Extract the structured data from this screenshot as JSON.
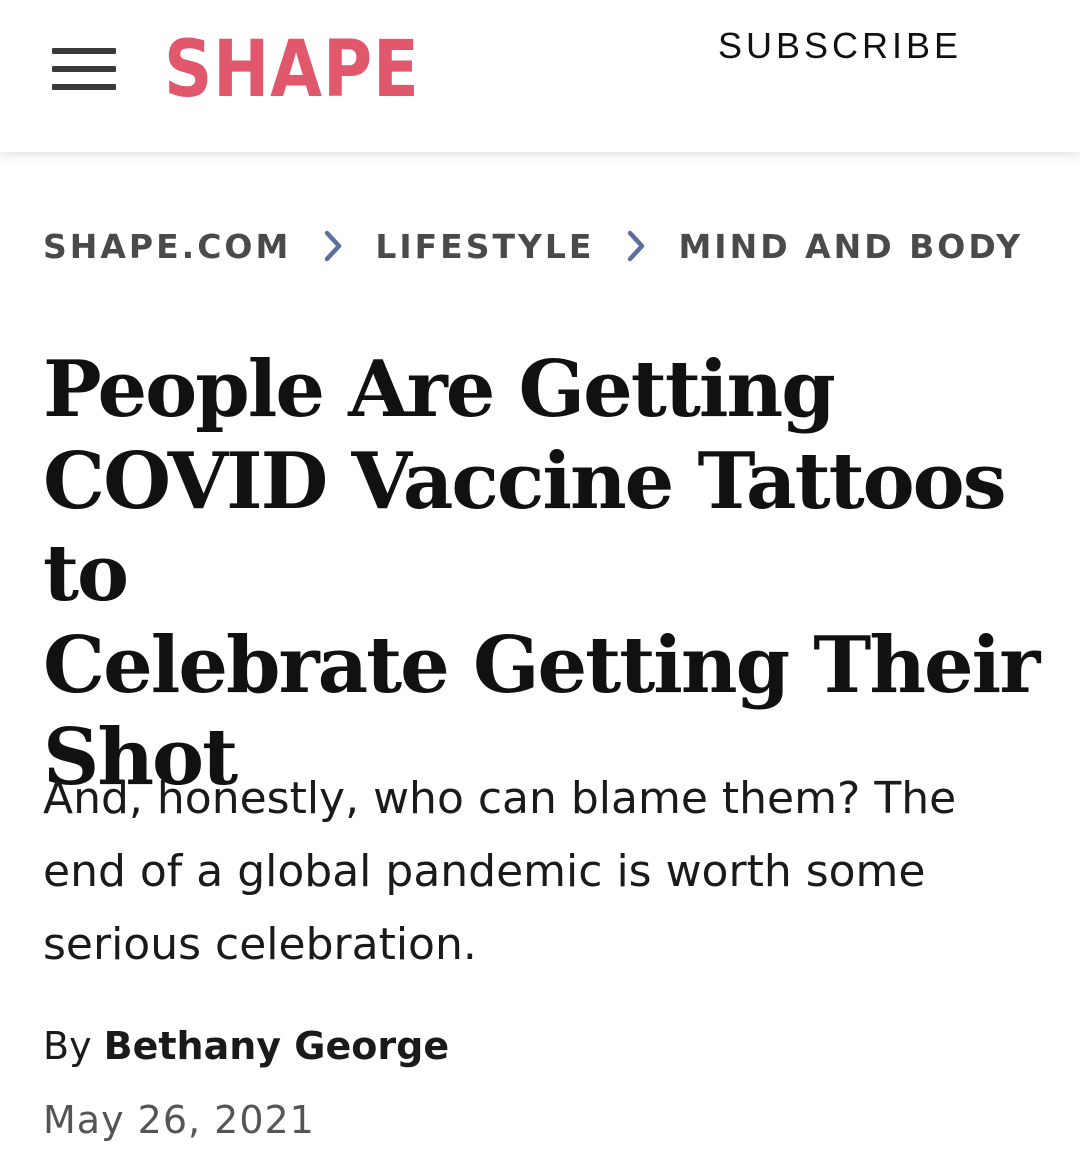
{
  "header": {
    "logo_text": "SHAPE",
    "subscribe_label": "SUBSCRIBE",
    "menu_icon": "hamburger-menu-icon",
    "brand_color": "#e1576c"
  },
  "breadcrumb": {
    "items": [
      {
        "label": "SHAPE.COM"
      },
      {
        "label": "LIFESTYLE"
      },
      {
        "label": "MIND AND BODY"
      }
    ],
    "separator_icon": "chevron-right-icon",
    "separator_color": "#5b6f9e"
  },
  "article": {
    "headline_lines": [
      "People Are Getting",
      "COVID Vaccine Tattoos to",
      "Celebrate Getting Their",
      "Shot"
    ],
    "dek_lines": [
      "And, honestly, who can blame them? The",
      "end of a global pandemic is worth some",
      "serious celebration."
    ],
    "byline_prefix": "By",
    "author": "Bethany George",
    "date": "May 26, 2021"
  }
}
